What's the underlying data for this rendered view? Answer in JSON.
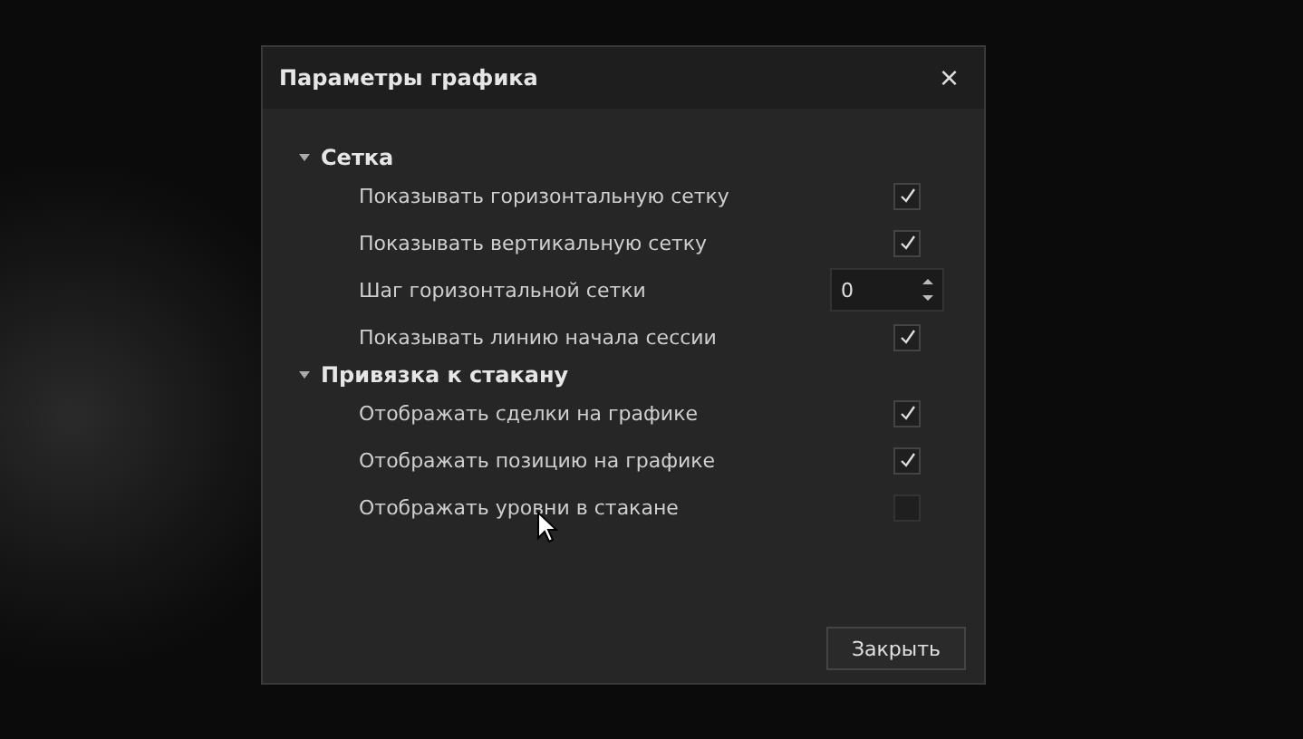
{
  "dialog": {
    "title": "Параметры графика",
    "close": "×"
  },
  "sections": [
    {
      "label": "Сетка",
      "expanded": true,
      "rows": [
        {
          "kind": "checkbox",
          "label": "Показывать горизонтальную сетку",
          "checked": true
        },
        {
          "kind": "checkbox",
          "label": "Показывать вертикальную сетку",
          "checked": true
        },
        {
          "kind": "number",
          "label": "Шаг горизонтальной сетки",
          "value": "0"
        },
        {
          "kind": "checkbox",
          "label": "Показывать линию начала сессии",
          "checked": true
        }
      ]
    },
    {
      "label": "Привязка к стакану",
      "expanded": true,
      "rows": [
        {
          "kind": "checkbox",
          "label": "Отображать сделки на графике",
          "checked": true
        },
        {
          "kind": "checkbox",
          "label": "Отображать позицию на графике",
          "checked": true
        },
        {
          "kind": "checkbox",
          "label": "Отображать уровни в стакане",
          "checked": false
        }
      ]
    }
  ],
  "buttons": [
    "Закрыть"
  ]
}
